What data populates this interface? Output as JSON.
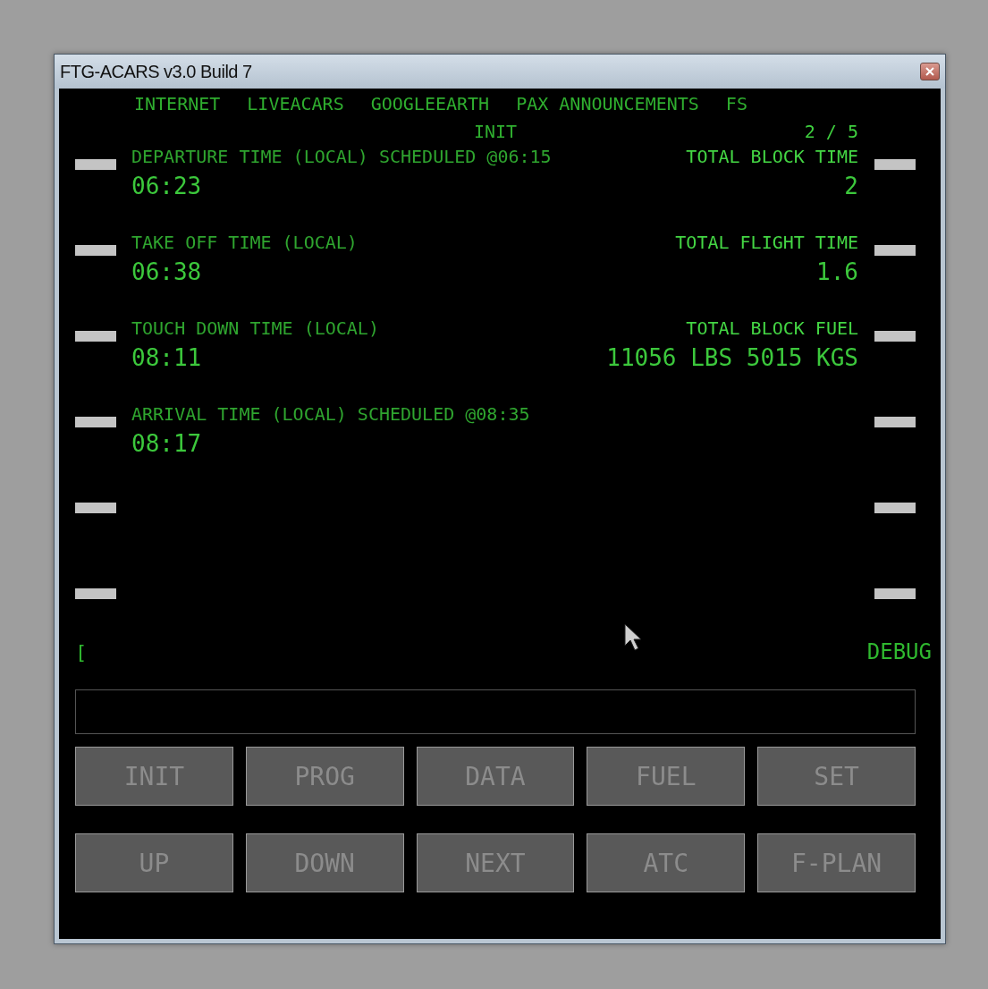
{
  "window": {
    "title": "FTG-ACARS v3.0 Build 7"
  },
  "menu": [
    "INTERNET",
    "LIVEACARS",
    "GOOGLEEARTH",
    "PAX ANNOUNCEMENTS",
    "FS"
  ],
  "page": {
    "title": "INIT",
    "number": "2 / 5"
  },
  "rows": [
    {
      "left": {
        "label": "DEPARTURE TIME (LOCAL) SCHEDULED @06:15",
        "value": "06:23"
      },
      "right": {
        "label": "TOTAL BLOCK TIME",
        "value": "2"
      }
    },
    {
      "left": {
        "label": "TAKE OFF TIME (LOCAL)",
        "value": "06:38"
      },
      "right": {
        "label": "TOTAL FLIGHT TIME",
        "value": "1.6"
      }
    },
    {
      "left": {
        "label": "TOUCH DOWN TIME (LOCAL)",
        "value": "08:11"
      },
      "right": {
        "label": "TOTAL BLOCK FUEL",
        "value": "11056 LBS 5015 KGS"
      }
    },
    {
      "left": {
        "label": "ARRIVAL TIME (LOCAL) SCHEDULED @08:35",
        "value": "08:17"
      }
    },
    {},
    {}
  ],
  "debug": "DEBUG",
  "scratchpad_mark": "[",
  "buttons": [
    [
      "INIT",
      "PROG",
      "DATA",
      "FUEL",
      "SET"
    ],
    [
      "UP",
      "DOWN",
      "NEXT",
      "ATC",
      "F-PLAN"
    ]
  ]
}
